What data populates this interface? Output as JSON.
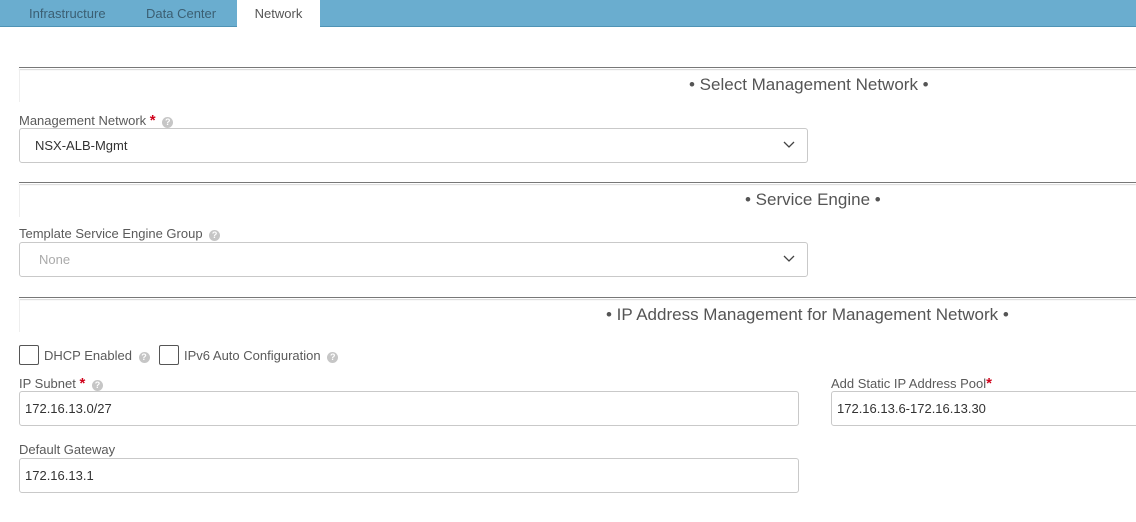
{
  "tabs": [
    {
      "label": "Infrastructure",
      "active": false
    },
    {
      "label": "Data Center",
      "active": false
    },
    {
      "label": "Network",
      "active": true
    }
  ],
  "sections": {
    "management": {
      "title": "• Select Management Network •",
      "network_label": "Management Network",
      "required_mark": "*",
      "help_icon": "?",
      "network_value": "NSX-ALB-Mgmt"
    },
    "service_engine": {
      "title": "• Service Engine •",
      "group_label": "Template Service Engine Group",
      "help_icon": "?",
      "group_value": "None"
    },
    "ipam": {
      "title": "• IP Address Management for Management Network •",
      "dhcp_label": "DHCP Enabled",
      "dhcp_checked": false,
      "ipv6_label": "IPv6 Auto Configuration",
      "ipv6_checked": false,
      "help_icon": "?",
      "subnet_label": "IP Subnet",
      "subnet_required": "*",
      "subnet_value": "172.16.13.0/27",
      "pool_label": "Add Static IP Address Pool",
      "pool_required": "*",
      "pool_value": "172.16.13.6-172.16.13.30",
      "gateway_label": "Default Gateway",
      "gateway_value": "172.16.13.1"
    }
  }
}
